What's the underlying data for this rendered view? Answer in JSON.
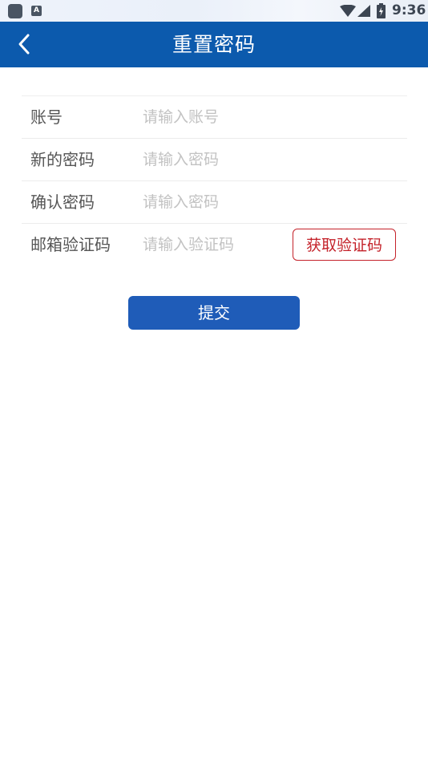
{
  "status_bar": {
    "notification_glyph": "A",
    "time": "9:36",
    "icons": [
      "app-icon",
      "notification-icon",
      "wifi-icon",
      "signal-icon",
      "battery-icon"
    ]
  },
  "header": {
    "title": "重置密码",
    "back_icon": "chevron-left-icon",
    "background_color": "#0c5aad"
  },
  "form": {
    "rows": [
      {
        "label": "账号",
        "placeholder": "请输入账号",
        "value": ""
      },
      {
        "label": "新的密码",
        "placeholder": "请输入密码",
        "value": ""
      },
      {
        "label": "确认密码",
        "placeholder": "请输入密码",
        "value": ""
      },
      {
        "label": "邮箱验证码",
        "placeholder": "请输入验证码",
        "value": ""
      }
    ],
    "get_code_label": "获取验证码",
    "get_code_color": "#c4222a"
  },
  "submit": {
    "label": "提交",
    "color": "#1f5cb8"
  }
}
